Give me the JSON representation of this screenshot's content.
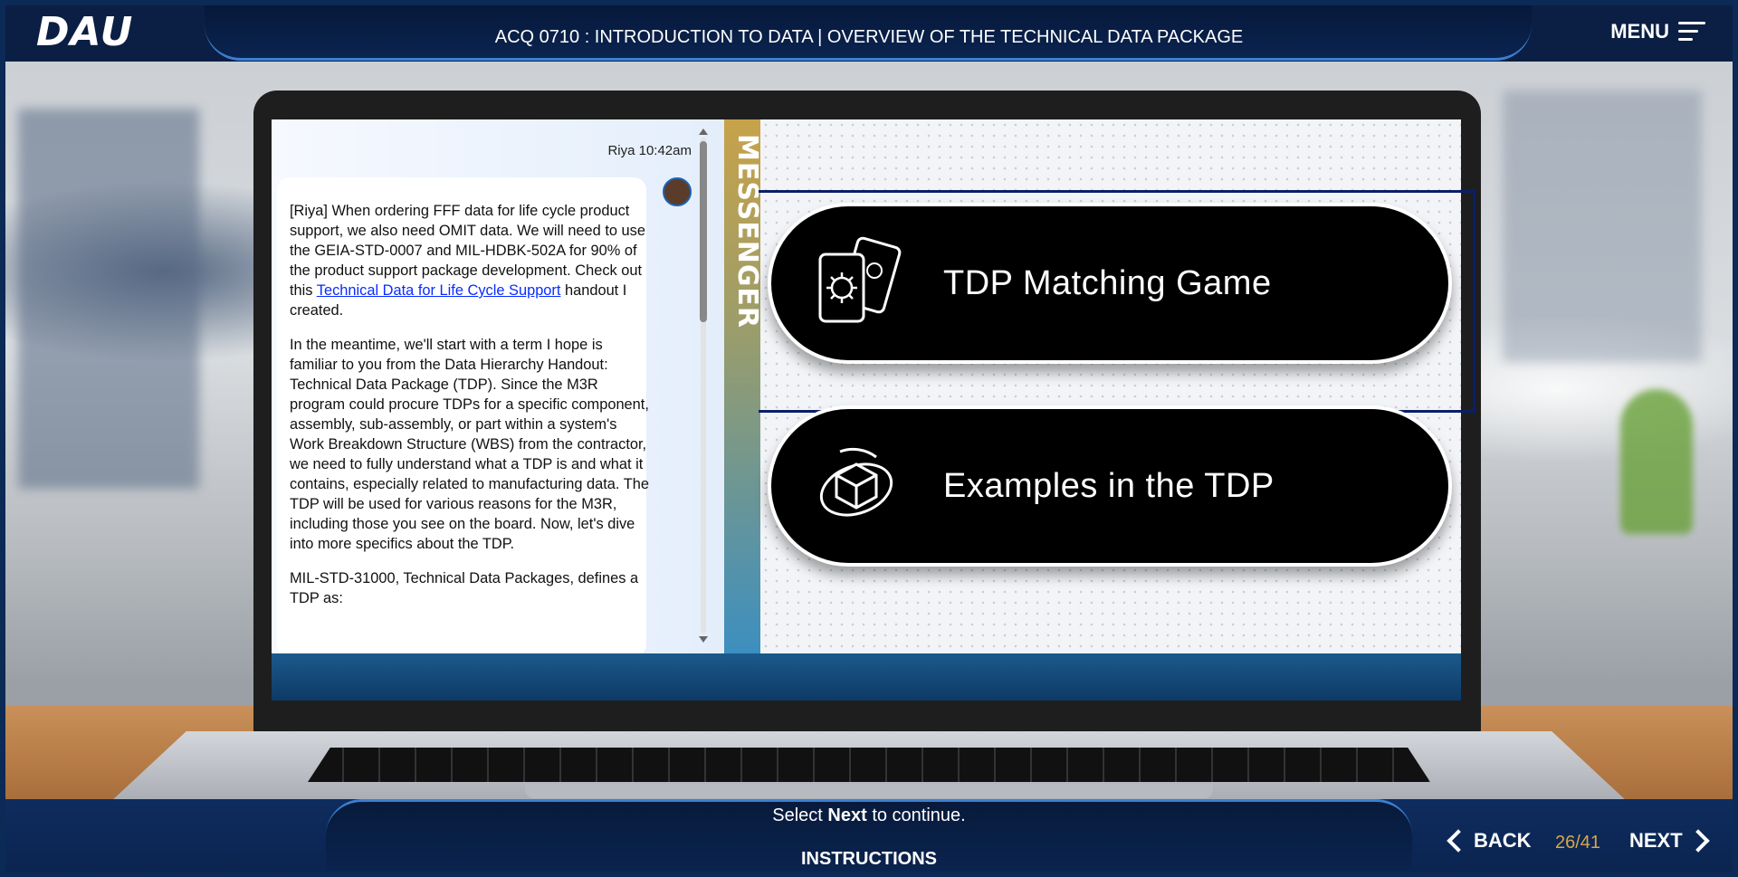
{
  "header": {
    "logo": "DAU",
    "title": "ACQ 0710 : INTRODUCTION TO DATA | OVERVIEW OF THE TECHNICAL DATA PACKAGE",
    "menu_label": "MENU"
  },
  "messenger": {
    "tab_label": "MESSENGER",
    "meta": "Riya 10:42am",
    "message": {
      "p1_before_link": "[Riya] When ordering FFF data for life cycle product support, we also need OMIT data. We will need to use the GEIA-STD-0007 and MIL-HDBK-502A for 90% of the product support package development. Check out this ",
      "p1_link": "Technical Data for Life Cycle Support",
      "p1_after_link": " handout I created.",
      "p2": "In the meantime, we'll start with a term I hope is familiar to you from the Data Hierarchy Handout: Technical Data Package (TDP). Since the M3R program could procure TDPs for a specific component, assembly, sub-assembly, or part within a system's Work Breakdown Structure (WBS) from the contractor, we need to fully understand what a TDP is and what it contains, especially related to manufacturing data. The TDP will be used for various reasons for the M3R, including those you see on the board. Now, let's dive into more specifics about the TDP.",
      "p3": "MIL-STD-31000, Technical Data Packages, defines a TDP as:"
    }
  },
  "board": {
    "cards": [
      {
        "label": "TDP Matching Game",
        "icon": "cards-icon"
      },
      {
        "label": "Examples in the TDP",
        "icon": "rotate-cube-icon"
      }
    ]
  },
  "footer": {
    "instruction_prefix": "Select ",
    "instruction_bold": "Next",
    "instruction_suffix": " to continue.",
    "instructions_label": "INSTRUCTIONS",
    "back_label": "BACK",
    "next_label": "NEXT",
    "page_indicator": "26/41"
  }
}
